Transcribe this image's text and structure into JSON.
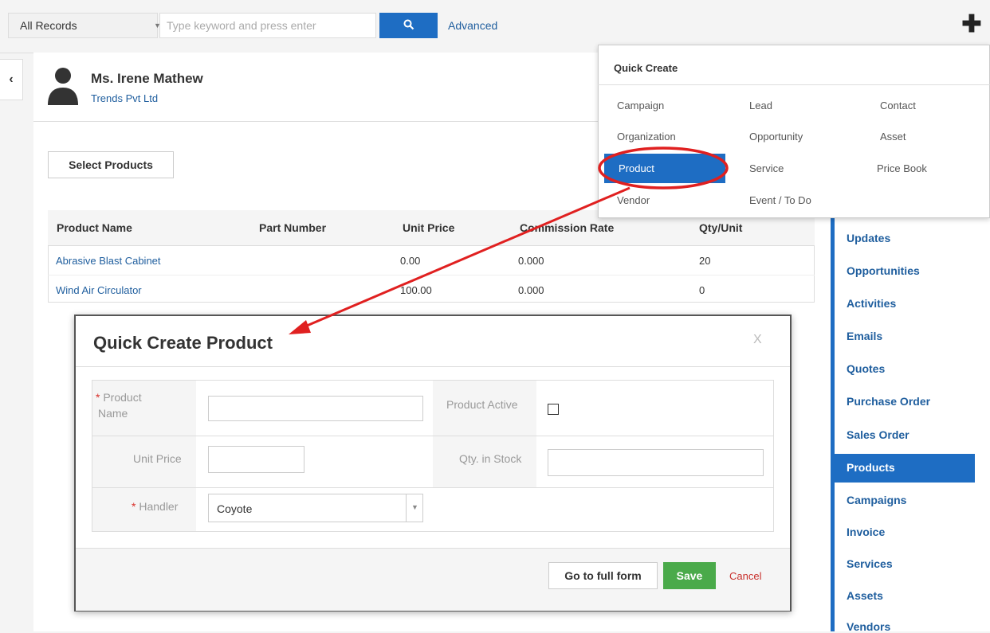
{
  "topbar": {
    "record_filter": "All Records",
    "search_placeholder": "Type keyword and press enter",
    "advanced_label": "Advanced",
    "plus_icon": "plus-icon"
  },
  "record": {
    "name": "Ms. Irene Mathew",
    "organization": "Trends Pvt Ltd",
    "collapse_icon": "chevron-left-icon",
    "avatar_icon": "person-icon"
  },
  "products": {
    "select_button": "Select Products",
    "columns": [
      "Product Name",
      "Part Number",
      "Unit Price",
      "Commission Rate",
      "Qty/Unit"
    ],
    "rows": [
      {
        "name": "Abrasive Blast Cabinet",
        "part": "",
        "unit_price": "0.00",
        "commission": "0.000",
        "qty": "20"
      },
      {
        "name": "Wind Air Circulator",
        "part": "",
        "unit_price": "100.00",
        "commission": "0.000",
        "qty": "0"
      }
    ]
  },
  "quick_create_menu": {
    "title": "Quick Create",
    "items": [
      "Campaign",
      "Lead",
      "Contact",
      "Organization",
      "Opportunity",
      "Asset",
      "Product",
      "Service",
      "Price Book",
      "Vendor",
      "Event / To Do"
    ],
    "selected": "Product",
    "highlight_color": "#e02020"
  },
  "sidebar": {
    "items": [
      "Updates",
      "Opportunities",
      "Activities",
      "Emails",
      "Quotes",
      "Purchase Order",
      "Sales Order",
      "Products",
      "Campaigns",
      "Invoice",
      "Services",
      "Assets",
      "Vendors"
    ],
    "active": "Products",
    "accent": "#1e6dc3"
  },
  "modal": {
    "title": "Quick Create Product",
    "close": "X",
    "fields": {
      "required_marker": "*",
      "product_name_line1": "Product",
      "product_name_line2": "Name",
      "product_active": "Product Active",
      "unit_price": "Unit Price",
      "qty_in_stock": "Qty. in Stock",
      "handler": "Handler",
      "handler_value": "Coyote"
    },
    "full_form_label": "Go to full form",
    "save_label": "Save",
    "cancel_label": "Cancel"
  }
}
